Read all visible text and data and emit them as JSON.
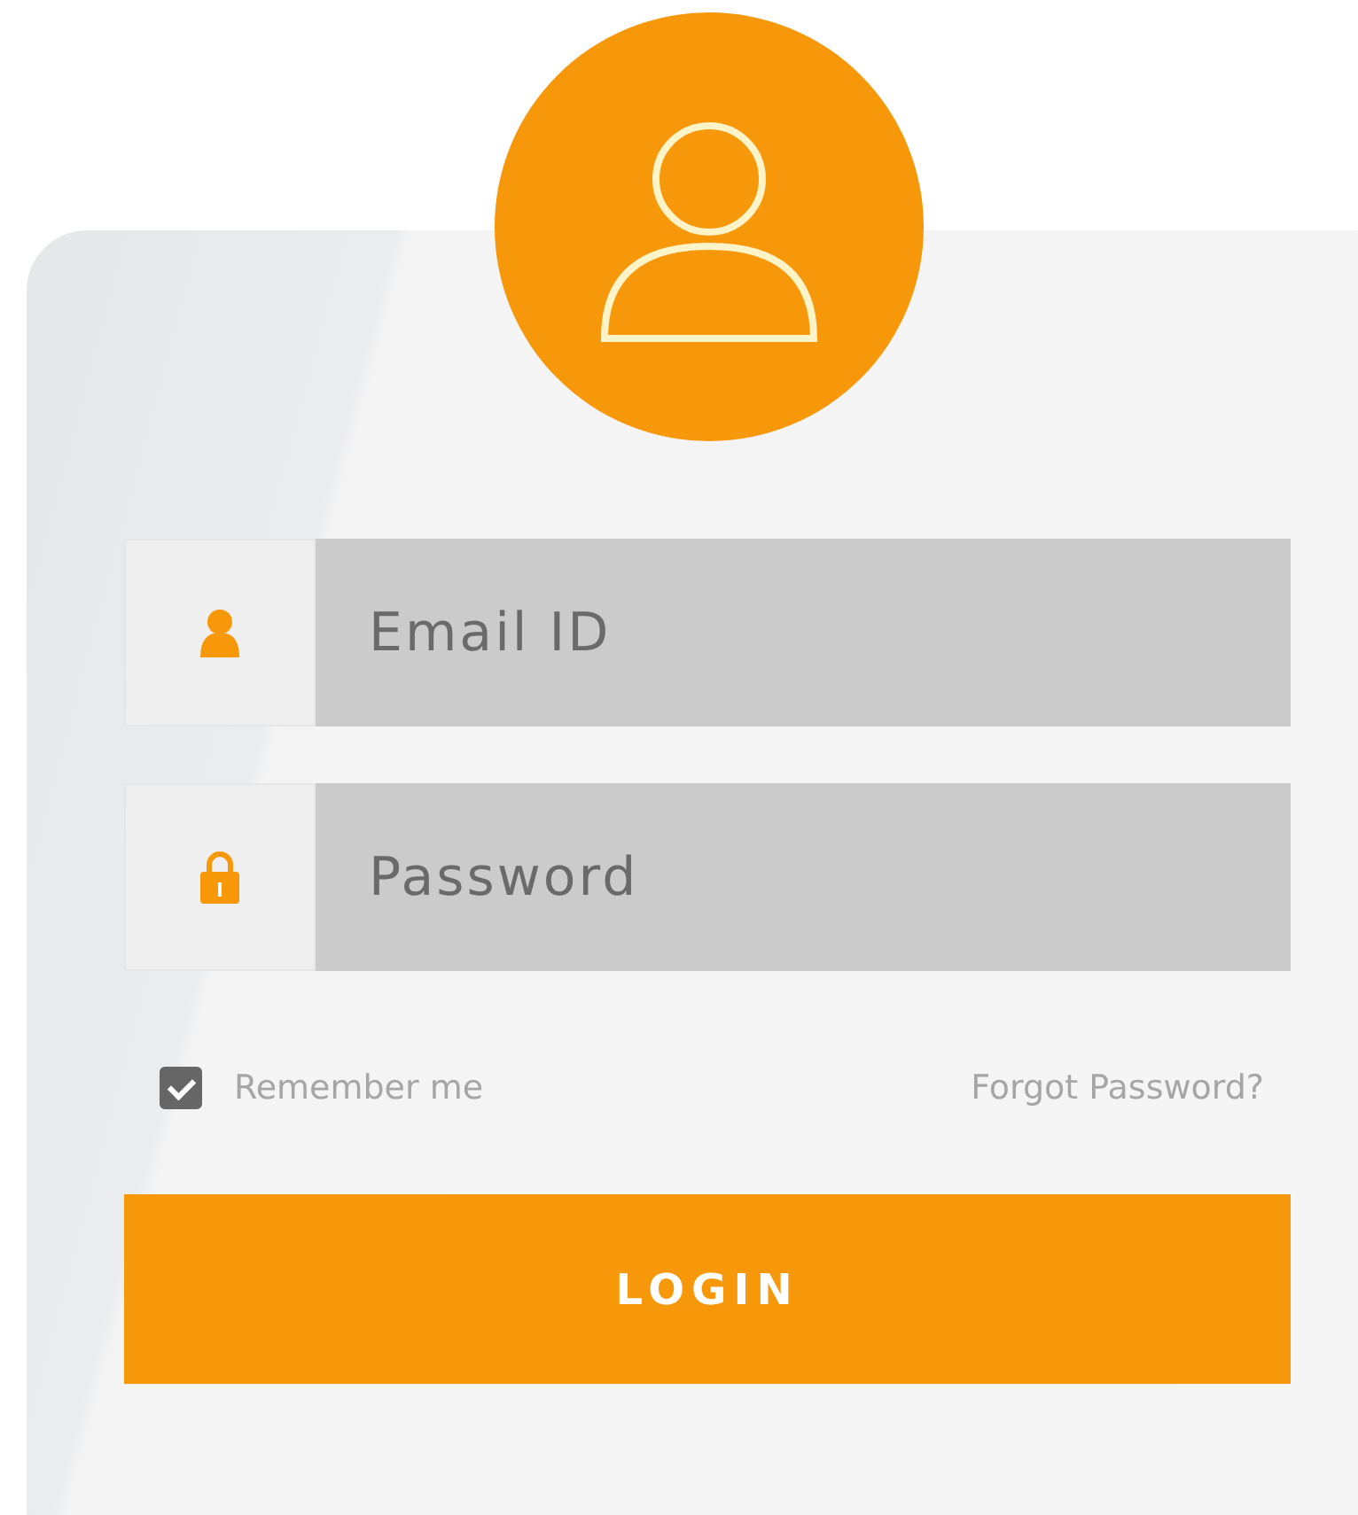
{
  "fields": [
    {
      "kind": "email",
      "placeholder": "Email ID"
    },
    {
      "kind": "password",
      "placeholder": "Password"
    }
  ],
  "remember": {
    "label": "Remember me",
    "checked": true
  },
  "forgot_link": "Forgot Password?",
  "login_button": "LOGIN"
}
